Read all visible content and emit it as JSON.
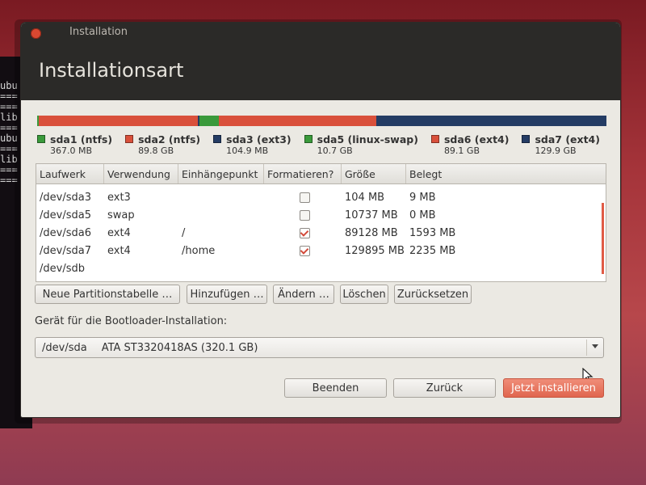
{
  "terminal": {
    "lines": [
      "ubu",
      "===",
      "===",
      "lib",
      "===",
      "ubu",
      "===",
      "lib",
      "===",
      "==="
    ]
  },
  "window": {
    "title": "Installation",
    "heading": "Installationsart"
  },
  "partition_bar": {
    "segments": [
      {
        "name": "sda1",
        "size_gb": 0.367,
        "color": "#3a9a3b"
      },
      {
        "name": "sda2",
        "size_gb": 89.8,
        "color": "#d9503b"
      },
      {
        "name": "sda3",
        "size_gb": 0.105,
        "color": "#243c64"
      },
      {
        "name": "sda5",
        "size_gb": 10.7,
        "color": "#3a9a3b"
      },
      {
        "name": "sda6",
        "size_gb": 89.1,
        "color": "#d9503b"
      },
      {
        "name": "sda7",
        "size_gb": 129.9,
        "color": "#243c64"
      }
    ]
  },
  "legend": [
    {
      "name": "sda1 (ntfs)",
      "size": "367.0 MB",
      "color": "#3a9a3b"
    },
    {
      "name": "sda2 (ntfs)",
      "size": "89.8 GB",
      "color": "#d9503b"
    },
    {
      "name": "sda3 (ext3)",
      "size": "104.9 MB",
      "color": "#243c64"
    },
    {
      "name": "sda5 (linux-swap)",
      "size": "10.7 GB",
      "color": "#3a9a3b"
    },
    {
      "name": "sda6 (ext4)",
      "size": "89.1 GB",
      "color": "#d9503b"
    },
    {
      "name": "sda7 (ext4)",
      "size": "129.9 GB",
      "color": "#243c64"
    }
  ],
  "table": {
    "headers": [
      "Laufwerk",
      "Verwendung",
      "Einhängepunkt",
      "Formatieren?",
      "Größe",
      "Belegt"
    ],
    "rows": [
      {
        "device": "/dev/sda3",
        "use": "ext3",
        "mount": "",
        "format": false,
        "size": "104 MB",
        "used": "9 MB"
      },
      {
        "device": "/dev/sda5",
        "use": "swap",
        "mount": "",
        "format": false,
        "size": "10737 MB",
        "used": "0 MB"
      },
      {
        "device": "/dev/sda6",
        "use": "ext4",
        "mount": "/",
        "format": true,
        "size": "89128 MB",
        "used": "1593 MB"
      },
      {
        "device": "/dev/sda7",
        "use": "ext4",
        "mount": "/home",
        "format": true,
        "size": "129895 MB",
        "used": "2235 MB"
      },
      {
        "device": "/dev/sdb",
        "use": "",
        "mount": "",
        "format": null,
        "size": "",
        "used": ""
      }
    ]
  },
  "buttons": {
    "new_table": "Neue Partitionstabelle …",
    "add": "Hinzufügen …",
    "change": "Ändern …",
    "delete": "Löschen",
    "reset": "Zurücksetzen"
  },
  "bootloader": {
    "label": "Gerät für die Bootloader-Installation:",
    "device": "/dev/sda",
    "description": "ATA ST3320418AS (320.1 GB)"
  },
  "footer": {
    "quit": "Beenden",
    "back": "Zurück",
    "install": "Jetzt installieren"
  }
}
